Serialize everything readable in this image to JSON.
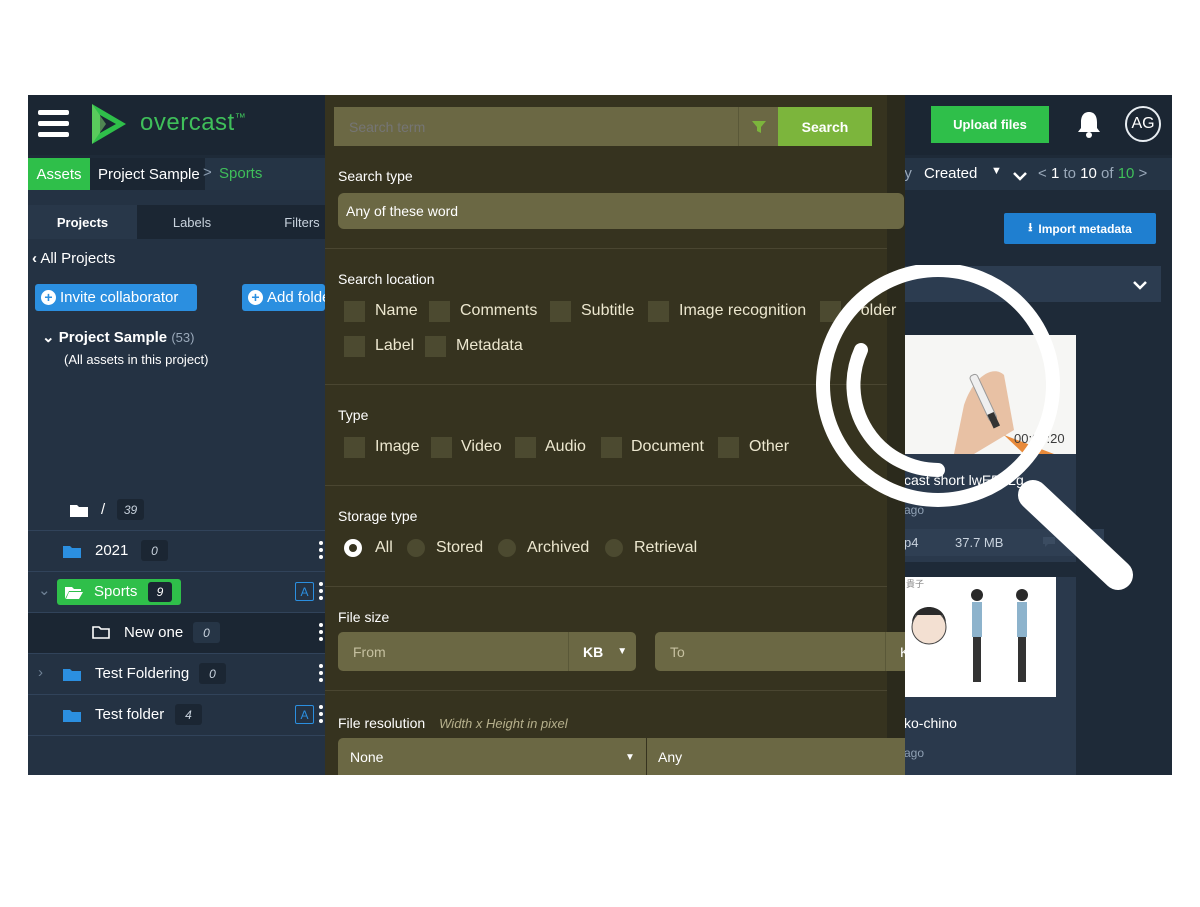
{
  "topbar": {
    "brand": "overcast",
    "trademark": "™",
    "upload_label": "Upload files",
    "avatar_initials": "AG",
    "brand_color": "#3fbf5a"
  },
  "breadcrumb": {
    "assets": "Assets",
    "project": "Project Sample",
    "separator": ">",
    "current": "Sports"
  },
  "sort": {
    "by_fragment": "by",
    "selected": "Created",
    "caret": "▼",
    "direction_icon": "chevron-down-icon",
    "pager_prev": "<",
    "pager_from": "1",
    "pager_to_word": "to",
    "pager_to": "10",
    "pager_of_word": "of",
    "pager_total": "10",
    "pager_next": ">"
  },
  "sidebar": {
    "tabs": [
      "Projects",
      "Labels",
      "Filters"
    ],
    "back_label": "All Projects",
    "invite_label": "Invite collaborator",
    "add_folder_label": "Add folder",
    "project_title": "Project Sample",
    "project_count": "(53)",
    "project_subtitle": "(All assets in this project)",
    "folders": [
      {
        "label": "/",
        "count": "39"
      },
      {
        "label": "2021",
        "count": "0"
      },
      {
        "label": "Sports",
        "count": "9"
      },
      {
        "label": "New one",
        "count": "0"
      },
      {
        "label": "Test Foldering",
        "count": "0"
      },
      {
        "label": "Test folder",
        "count": "4"
      }
    ],
    "assigned_badge": "A"
  },
  "content": {
    "import_label": "Import metadata",
    "card1": {
      "duration": "00:00:20",
      "title": "cast short lw",
      "title_tail": "E5Y2g...",
      "age": "ago",
      "ext": "p4",
      "size": "37.7 MB"
    },
    "card2": {
      "title": "ko-chino",
      "age": "ago",
      "thumb_caption": "貴子"
    }
  },
  "search_panel": {
    "search_placeholder": "Search term",
    "search_button": "Search",
    "search_type_title": "Search type",
    "search_type_value": "Any of these word",
    "location_title": "Search location",
    "locations": [
      "Name",
      "Comments",
      "Subtitle",
      "Image recognition",
      "Folder",
      "Label",
      "Metadata"
    ],
    "type_title": "Type",
    "types": [
      "Image",
      "Video",
      "Audio",
      "Document",
      "Other"
    ],
    "storage_title": "Storage type",
    "storage_options": [
      "All",
      "Stored",
      "Archived",
      "Retrieval"
    ],
    "storage_selected": "All",
    "filesize_title": "File size",
    "from_placeholder": "From",
    "to_placeholder": "To",
    "unit": "KB",
    "to_unit_fragment": "K",
    "resolution_title": "File resolution",
    "resolution_hint": "Width x Height in pixel",
    "resolution_value": "None",
    "resolution_any": "Any",
    "panel_color": "#36331f",
    "accent_color": "#7cb53c"
  }
}
